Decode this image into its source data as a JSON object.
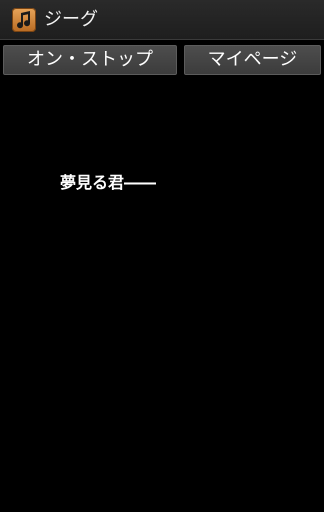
{
  "titlebar": {
    "app_icon": "music-note-icon",
    "title": "ジーグ"
  },
  "toolbar": {
    "nonstop_label": "オン・ストップ",
    "mypage_label": "マイページ"
  },
  "content": {
    "lyric_line": "夢見る君――"
  },
  "colors": {
    "background": "#000000",
    "titlebar": "#1e1e1e",
    "button": "#444444",
    "icon_accent": "#d08a3a",
    "text": "#ffffff"
  }
}
